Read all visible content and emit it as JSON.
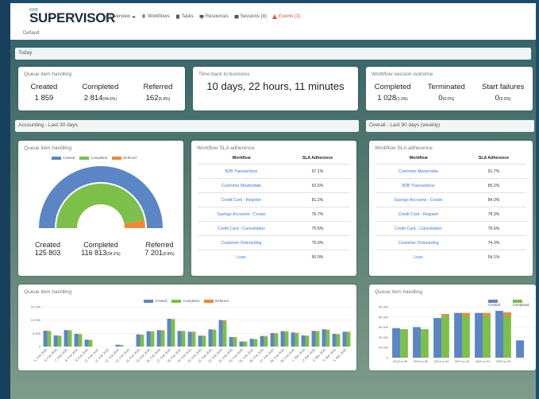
{
  "app": {
    "small": "KKB",
    "title": "SUPERVISOR",
    "subtitle": "Default"
  },
  "nav": [
    {
      "label": "Overview",
      "icon": "chart-icon",
      "dropdown": true
    },
    {
      "label": "Workflows",
      "icon": "workflow-icon"
    },
    {
      "label": "Tasks",
      "icon": "tasks-icon"
    },
    {
      "label": "Resources",
      "icon": "monitor-icon"
    },
    {
      "label": "Sessions (8)",
      "icon": "sessions-icon"
    },
    {
      "label": "Events (3)",
      "icon": "warning-icon",
      "color": "#d9534f"
    }
  ],
  "today": {
    "label": "Today",
    "queue": {
      "title": "Queue item handling",
      "created": {
        "label": "Created",
        "value": "1 859"
      },
      "completed": {
        "label": "Completed",
        "value": "2 814",
        "pct": "(94.6%)"
      },
      "referred": {
        "label": "Referred",
        "value": "162",
        "pct": "(5.4%)"
      }
    },
    "time": {
      "title": "Time back to business",
      "value": "10 days, 22 hours, 11 minutes"
    },
    "outcome": {
      "title": "Workflow session outcome",
      "completed": {
        "label": "Completed",
        "value": "1 028",
        "pct": "(1.0%)"
      },
      "terminated": {
        "label": "Terminated",
        "value": "0",
        "pct": "(0.0%)"
      },
      "failures": {
        "label": "Start failures",
        "value": "0",
        "pct": "(0.0%)"
      }
    }
  },
  "accounting": {
    "label": "Accounting - Last 30 days",
    "gauge": {
      "title": "Queue item handling",
      "legend": [
        "Created",
        "Completed",
        "Referred"
      ],
      "created": {
        "label": "Created",
        "value": "125 803"
      },
      "completed": {
        "label": "Completed",
        "value": "116 813",
        "pct": "(94.2%)"
      },
      "referred": {
        "label": "Referred",
        "value": "7 201",
        "pct": "(5.8%)"
      },
      "completed_fraction": 0.942,
      "referred_fraction": 0.058
    },
    "sla": {
      "title": "Workflow SLA adherence",
      "headers": [
        "Workflow",
        "SLA Adherence"
      ],
      "rows": [
        [
          "B2B Transactions",
          "97.1%"
        ],
        [
          "Customer Masterdata",
          "92.6%"
        ],
        [
          "Credit Card - Register",
          "81.2%"
        ],
        [
          "Savings Accounts - Create",
          "76.7%"
        ],
        [
          "Credit Card - Cancellation",
          "75.6%"
        ],
        [
          "Customer Onboarding",
          "75.0%"
        ],
        [
          "Loan",
          "50.0%"
        ]
      ]
    },
    "bar": {
      "title": "Queue item handling",
      "legend": [
        "Created",
        "Completed",
        "Referred"
      ]
    }
  },
  "overall": {
    "label": "Overall - Last 90 days (weekly)",
    "sla": {
      "title": "Workflow SLA adherence",
      "headers": [
        "Workflow",
        "SLA Adherence"
      ],
      "rows": [
        [
          "Customer Masterdata",
          "91.7%"
        ],
        [
          "B2B Transactions",
          "85.2%"
        ],
        [
          "Savings Accounts - Create",
          "84.2%"
        ],
        [
          "Credit Card - Register",
          "78.3%"
        ],
        [
          "Credit Card - Cancellation",
          "76.6%"
        ],
        [
          "Customer Onboarding",
          "74.3%"
        ],
        [
          "Loan",
          "54.1%"
        ]
      ]
    },
    "bar": {
      "title": "Queue item handling",
      "legend": [
        "Created",
        "Completed"
      ]
    }
  },
  "colors": {
    "created": "#5b86c5",
    "completed": "#7cc04a",
    "referred": "#f0883a"
  },
  "chart_data": [
    {
      "type": "bar",
      "title": "Queue item handling",
      "ylim": [
        0,
        15000
      ],
      "yticks": [
        "15 000",
        "10 000",
        "5 000",
        "0"
      ],
      "categories": [
        "5. Feb 2020",
        "6. Feb 2020",
        "7. Feb 2020",
        "8. Feb 2020",
        "9. Feb 2020",
        "10. Feb 2020",
        "11. Feb 2020",
        "12. Feb 2020",
        "13. Feb 2020",
        "14. Feb 2020",
        "15. Feb 2020",
        "16. Feb 2020",
        "17. Feb 2020",
        "18. Feb 2020",
        "19. Feb 2020",
        "20. Feb 2020",
        "21. Feb 2020",
        "22. Feb 2020",
        "23. Feb 2020",
        "24. Feb 2020",
        "25. Feb 2020",
        "26. Feb 2020",
        "27. Feb 2020",
        "28. Feb 2020",
        "29. Feb 2020",
        "1. Mar 2020",
        "2. Mar 2020",
        "3. Mar 2020",
        "4. Mar 2020",
        "5. Mar 2020"
      ],
      "series": [
        {
          "name": "Created",
          "values": [
            6000,
            4200,
            6200,
            4800,
            2600,
            0,
            0,
            700,
            0,
            4600,
            5800,
            6200,
            10500,
            5900,
            5600,
            4100,
            6500,
            10000,
            3600,
            1900,
            2900,
            4000,
            5100,
            5800,
            5300,
            4200,
            5900,
            6500,
            4800,
            5600
          ]
        },
        {
          "name": "Completed",
          "values": [
            5600,
            3900,
            5900,
            4500,
            2400,
            0,
            0,
            600,
            0,
            4300,
            5500,
            5900,
            9900,
            5600,
            5300,
            3900,
            6100,
            9400,
            3400,
            1800,
            2700,
            3800,
            4800,
            5500,
            5000,
            3900,
            5600,
            6100,
            4500,
            5300
          ]
        },
        {
          "name": "Referred",
          "values": [
            300,
            200,
            300,
            200,
            100,
            0,
            0,
            50,
            0,
            200,
            300,
            300,
            500,
            300,
            300,
            200,
            300,
            500,
            200,
            100,
            100,
            200,
            200,
            300,
            200,
            200,
            300,
            300,
            200,
            300
          ]
        }
      ]
    },
    {
      "type": "bar",
      "title": "Queue item handling",
      "ylim": [
        0,
        50000
      ],
      "yticks": [
        "50 000",
        "40 000",
        "30 000",
        "20 000",
        "10 000",
        "0"
      ],
      "categories": [
        "2019 w 49",
        "2019 w 50",
        "2019 w 51",
        "2019 w 52",
        "2020 w 01",
        "2020 w 02",
        ""
      ],
      "series": [
        {
          "name": "Created",
          "values": [
            29000,
            30000,
            39000,
            44000,
            44000,
            46000,
            17000
          ]
        },
        {
          "name": "Completed",
          "values": [
            28000,
            28000,
            41000,
            41000,
            41000,
            41000,
            0
          ]
        },
        {
          "name": "Referred",
          "values": [
            0,
            0,
            2000,
            3000,
            3000,
            3500,
            0
          ]
        }
      ]
    }
  ]
}
